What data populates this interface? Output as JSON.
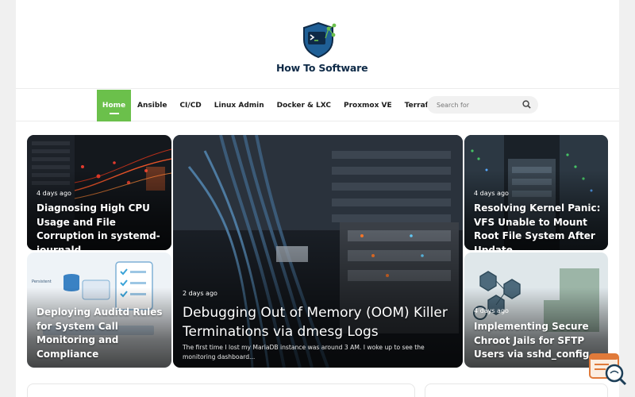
{
  "brand": {
    "name": "How To Software",
    "accent": "#6bc04b",
    "dark": "#0e2a47"
  },
  "nav": {
    "items": [
      {
        "label": "Home",
        "active": true
      },
      {
        "label": "Ansible"
      },
      {
        "label": "CI/CD"
      },
      {
        "label": "Linux Admin"
      },
      {
        "label": "Docker & LXC"
      },
      {
        "label": "Proxmox VE"
      },
      {
        "label": "Terraform IaC"
      }
    ]
  },
  "search": {
    "placeholder": "Search for",
    "icon": "search-icon"
  },
  "posts": {
    "featured": {
      "date": "2 days ago",
      "title": "Debugging Out of Memory (OOM) Killer Terminations via dmesg Logs",
      "excerpt": "The first time I lost my MariaDB instance was around 3 AM. I woke up to see the monitoring dashboard..."
    },
    "top_left": {
      "date": "4 days ago",
      "title": "Diagnosing High CPU Usage and File Corruption in systemd-journald"
    },
    "bottom_left": {
      "title": "Deploying Auditd Rules for System Call Monitoring and Compliance"
    },
    "top_right": {
      "date": "4 days ago",
      "title": "Resolving Kernel Panic: VFS Unable to Mount Root File System After Update"
    },
    "bottom_right": {
      "date": "4 days ago",
      "title": "Implementing Secure Chroot Jails for SFTP Users via sshd_config"
    }
  },
  "widget": {
    "icon": "chat-search-icon"
  }
}
